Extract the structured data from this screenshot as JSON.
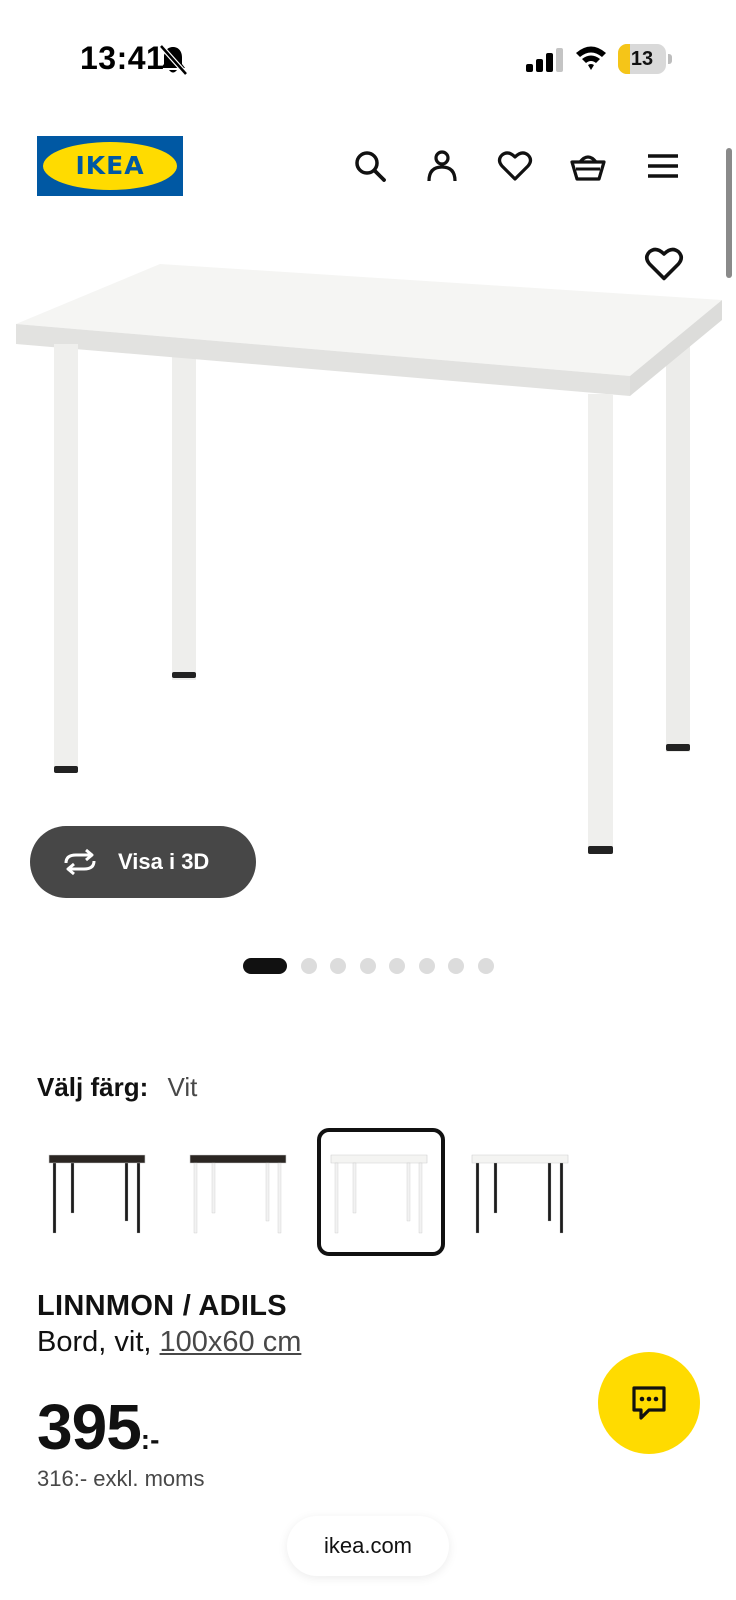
{
  "status_bar": {
    "time": "13:41",
    "battery_level": "13",
    "battery_fraction": 0.13,
    "icons": [
      "bell-slash-icon",
      "signal-icon",
      "wifi-icon",
      "battery-icon"
    ]
  },
  "header": {
    "logo_text": "IKEA",
    "brand_colors": {
      "blue": "#0058a3",
      "yellow": "#ffdb00"
    },
    "icons": [
      "search-icon",
      "account-icon",
      "heart-icon",
      "basket-icon",
      "menu-icon"
    ]
  },
  "gallery": {
    "view_3d_label": "Visa i 3D",
    "image_count": 8,
    "active_index": 0
  },
  "color_select": {
    "label": "Välj färg:",
    "selected": "Vit",
    "selected_index": 2,
    "options": [
      {
        "top": "#2b2622",
        "legs": "#1c1c1c"
      },
      {
        "top": "#2b2622",
        "legs": "#f2f2f2"
      },
      {
        "top": "#f4f4f2",
        "legs": "#f2f2f2"
      },
      {
        "top": "#f4f4f2",
        "legs": "#1c1c1c"
      }
    ]
  },
  "product": {
    "name": "LINNMON / ADILS",
    "desc_prefix": "Bord, vit, ",
    "size": "100x60 cm",
    "price_int": "395",
    "price_suffix": ":-",
    "price_ex_vat": "316:- exkl. moms"
  },
  "footer": {
    "url": "ikea.com"
  },
  "accent_chat_color": "#ffdb00"
}
